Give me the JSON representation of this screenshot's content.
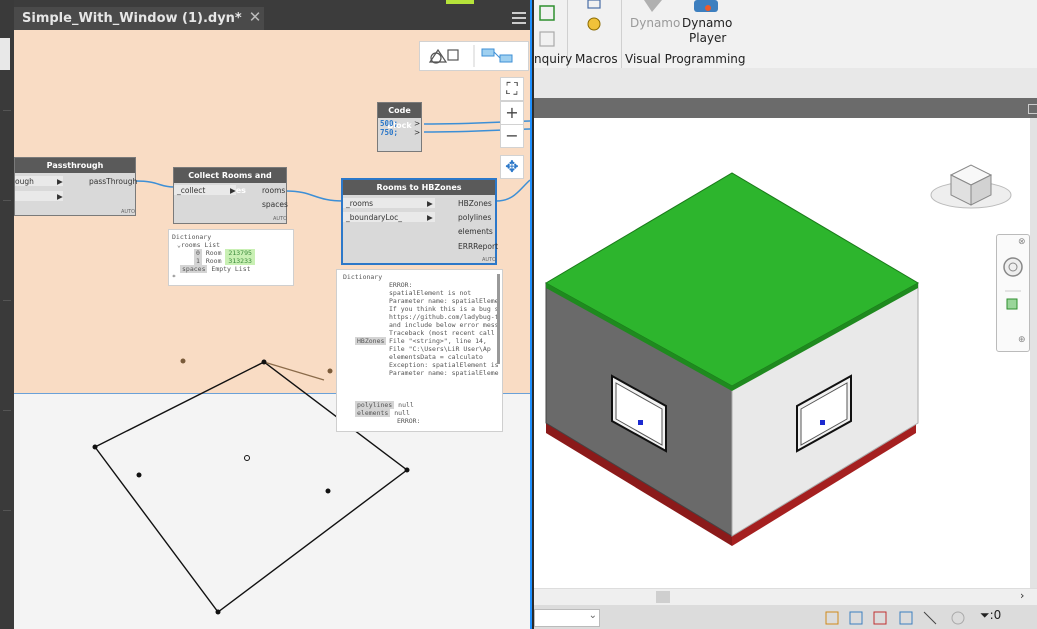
{
  "dynamo": {
    "file_tab": "Simple_With_Window (1).dyn*",
    "close_glyph": "✕",
    "zoom_in": "+",
    "zoom_out": "−"
  },
  "nodes": {
    "code_block": {
      "title": "Code Block",
      "lines": [
        "500;",
        "750;"
      ]
    },
    "passthrough": {
      "title": "Passthrough",
      "input1": "ough",
      "output": "passThrough",
      "auto": "AUTO"
    },
    "collect_rooms": {
      "title": "Collect Rooms and Spaces",
      "input": "_collect",
      "outputs": [
        "rooms",
        "spaces"
      ],
      "auto": "AUTO"
    },
    "rooms_to_hbzones": {
      "title": "Rooms to HBZones",
      "inputs": [
        "_rooms",
        "_boundaryLoc_"
      ],
      "outputs": [
        "HBZones",
        "polylines",
        "elements",
        "ERRReport"
      ],
      "auto": "AUTO"
    }
  },
  "collect_preview": {
    "type": "Dictionary",
    "rooms_key": "rooms",
    "list_label": "List",
    "items": [
      {
        "index": "0",
        "label": "Room",
        "value": "213795"
      },
      {
        "index": "1",
        "label": "Room",
        "value": "313233"
      }
    ],
    "spaces_key": "spaces",
    "spaces_value": "Empty List",
    "star": "*"
  },
  "hbzones_preview": {
    "type": "Dictionary",
    "hbzones_key": "HBZones",
    "lines": [
      "ERROR:",
      "      spatialElement is not",
      "Parameter name: spatialEleme",
      "",
      "If you think this is a bug s",
      "https://github.com/ladybug-t",
      "and include below error mess",
      "",
      "Traceback (most recent call",
      "  File \"<string>\", line 14,",
      "  File \"C:\\Users\\LiR User\\Ap",
      "    elementsData = calculato",
      "Exception: spatialElement is",
      "Parameter name: spatialEleme"
    ],
    "polylines_key": "polylines",
    "polylines_value": "null",
    "elements_key": "elements",
    "elements_value": "null",
    "tail": "ERROR:"
  },
  "ribbon": {
    "items": [
      "Dynamo",
      "Dynamo",
      "Player"
    ],
    "panels": [
      "nquiry",
      "Macros",
      "Visual Programming"
    ]
  },
  "status": {
    "filter_count": ":0"
  },
  "colors": {
    "accent": "#1e90ff",
    "roof": "#2db52d",
    "base": "#8b1a1a",
    "canvas": "#f9dcc4"
  }
}
